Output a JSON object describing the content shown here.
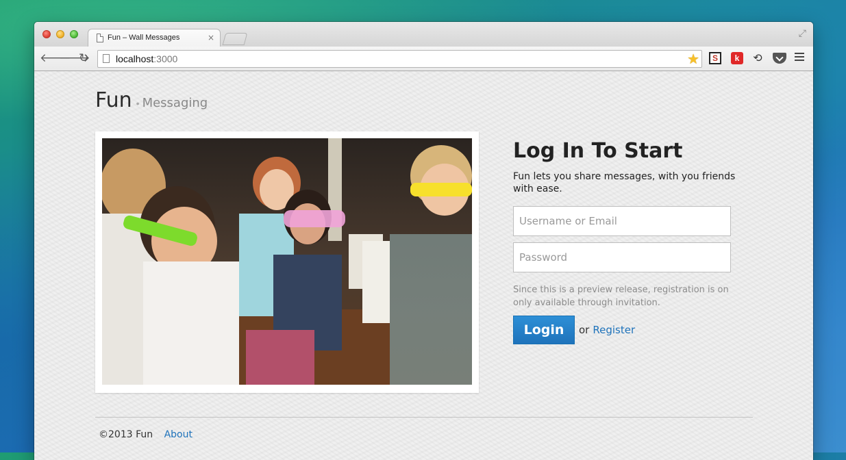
{
  "browser": {
    "tab_title": "Fun – Wall Messages",
    "tab_close": "×",
    "url_host": "localhost",
    "url_port": ":3000",
    "extensions": [
      "S",
      "k"
    ]
  },
  "site": {
    "brand": "Fun",
    "brand_sep": "•",
    "brand_sub": "Messaging"
  },
  "login": {
    "title": "Log In To Start",
    "description": "Fun lets you share messages, with you friends with ease.",
    "username_placeholder": "Username or Email",
    "password_placeholder": "Password",
    "note": "Since this is a preview release, registration is on only available through invitation.",
    "login_label": "Login",
    "or_text": "or",
    "register_label": "Register"
  },
  "footer": {
    "copyright": "©2013 Fun",
    "about_label": "About"
  },
  "colors": {
    "accent": "#1f73bb",
    "login_button": "#2a86cc"
  }
}
